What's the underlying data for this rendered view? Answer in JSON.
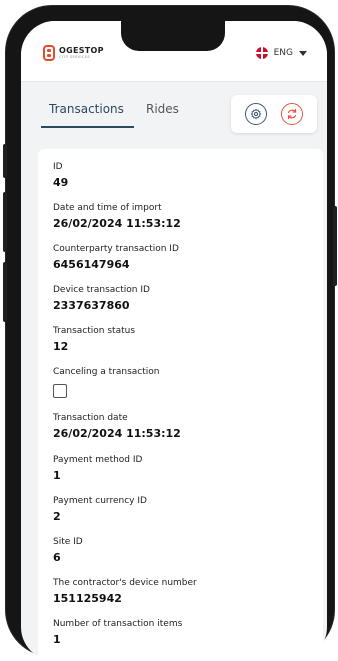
{
  "header": {
    "logo_name": "OGESTOP",
    "logo_sub": "CITY SERVICES",
    "language": "ENG"
  },
  "tabs": [
    {
      "label": "Transactions",
      "active": true
    },
    {
      "label": "Rides",
      "active": false
    }
  ],
  "colors": {
    "accent": "#2b4a5f",
    "refresh": "#e6543a",
    "brand": "#e24b2b"
  },
  "fields": {
    "id": {
      "label": "ID",
      "value": "49"
    },
    "import_datetime": {
      "label": "Date and time of import",
      "value": "26/02/2024 11:53:12"
    },
    "counterparty_id": {
      "label": "Counterparty transaction ID",
      "value": "6456147964"
    },
    "device_tx_id": {
      "label": "Device transaction ID",
      "value": "2337637860"
    },
    "tx_status": {
      "label": "Transaction status",
      "value": "12"
    },
    "canceling": {
      "label": "Canceling a transaction",
      "checked": false
    },
    "tx_date": {
      "label": "Transaction date",
      "value": "26/02/2024 11:53:12"
    },
    "payment_method": {
      "label": "Payment method ID",
      "value": "1"
    },
    "payment_currency": {
      "label": "Payment currency ID",
      "value": "2"
    },
    "site_id": {
      "label": "Site ID",
      "value": "6"
    },
    "device_number": {
      "label": "The contractor's device number",
      "value": "151125942"
    },
    "items_count": {
      "label": "Number of transaction items",
      "value": "1"
    }
  }
}
